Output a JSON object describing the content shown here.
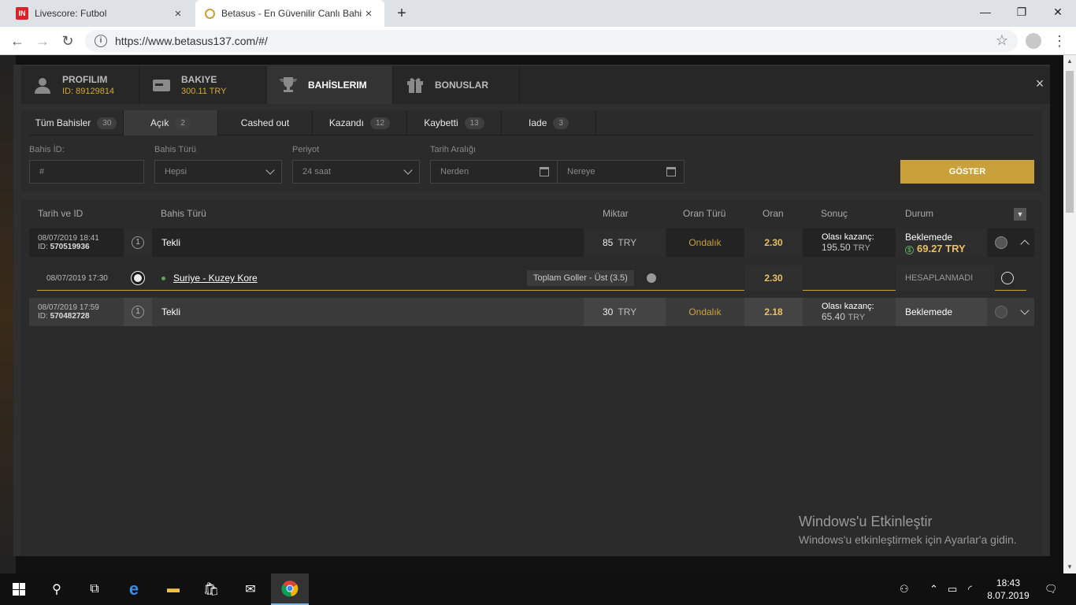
{
  "browser": {
    "tabs": [
      {
        "title": "Livescore: Futbol",
        "favicon": "IN"
      },
      {
        "title": "Betasus - En Güvenilir Canlı Bahis"
      }
    ],
    "url": "https://www.betasus137.com/#/"
  },
  "modal": {
    "tabs": [
      {
        "label": "PROFILIM",
        "sub": "ID: 89129814",
        "icon": "user-icon"
      },
      {
        "label": "BAKIYE",
        "sub": "300.11 TRY",
        "icon": "wallet-icon"
      },
      {
        "label": "BAHİSLERIM",
        "sub": "",
        "icon": "trophy-icon"
      },
      {
        "label": "BONUSLAR",
        "sub": "",
        "icon": "gift-icon"
      }
    ],
    "close": "×"
  },
  "filters": {
    "tabs": [
      {
        "label": "Tüm Bahisler",
        "count": "30"
      },
      {
        "label": "Açık",
        "count": "2"
      },
      {
        "label": "Cashed out",
        "count": ""
      },
      {
        "label": "Kazandı",
        "count": "12"
      },
      {
        "label": "Kaybetti",
        "count": "13"
      },
      {
        "label": "Iade",
        "count": "3"
      }
    ],
    "bet_id_label": "Bahis İD:",
    "bet_id_placeholder": "#",
    "bet_type_label": "Bahis Türü",
    "bet_type_value": "Hepsi",
    "period_label": "Periyot",
    "period_value": "24 saat",
    "date_range_label": "Tarih Aralığı",
    "from_placeholder": "Nerden",
    "to_placeholder": "Nereye",
    "show_button": "GÖSTER"
  },
  "table": {
    "headers": {
      "date_id": "Tarih ve ID",
      "type": "Bahis Türü",
      "amount": "Miktar",
      "odds_type": "Oran Türü",
      "odds": "Oran",
      "result": "Sonuç",
      "status": "Durum"
    },
    "rows": [
      {
        "date": "08/07/2019 18:41",
        "id_label": "ID:",
        "id": "570519936",
        "count": "1",
        "type": "Tekli",
        "amount": "85",
        "currency": "TRY",
        "odds_type": "Ondalık",
        "odds": "2.30",
        "result_label": "Olası kazanç:",
        "result_value": "195.50",
        "result_currency": "TRY",
        "status": "Beklemede",
        "cashout": "69.27 TRY"
      },
      {
        "date": "08/07/2019 17:59",
        "id_label": "ID:",
        "id": "570482728",
        "count": "1",
        "type": "Tekli",
        "amount": "30",
        "currency": "TRY",
        "odds_type": "Ondalık",
        "odds": "2.18",
        "result_label": "Olası kazanç:",
        "result_value": "65.40",
        "result_currency": "TRY",
        "status": "Beklemede"
      }
    ],
    "selection": {
      "date": "08/07/2019 17:30",
      "match": "Suriye - Kuzey Kore",
      "market": "Toplam Goller - Üst (3.5)",
      "odds": "2.30",
      "status": "HESAPLANMADI"
    }
  },
  "watermark": {
    "line1": "Windows'u Etkinleştir",
    "line2": "Windows'u etkinleştirmek için Ayarlar'a gidin."
  },
  "taskbar": {
    "time": "18:43",
    "date": "8.07.2019"
  },
  "colors": {
    "accent": "#c9a13a",
    "odds": "#e9c063"
  }
}
